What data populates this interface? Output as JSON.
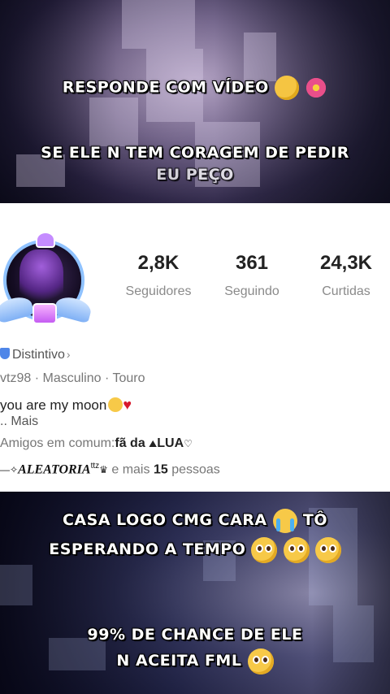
{
  "overlay": {
    "line1": "RESPONDE COM VÍDEO",
    "line2a": "SE ELE N TEM CORAGEM DE PEDIR",
    "line2b": "EU PEÇO",
    "line3a": "CASA LOGO CMG CARA",
    "line3a_tail": "TÔ",
    "line3b": "ESPERANDO A TEMPO",
    "line4a": "99% DE CHANCE DE ELE",
    "line4b": "N ACEITA FML"
  },
  "profile": {
    "stats": [
      {
        "value": "2,8K",
        "label": "Seguidores"
      },
      {
        "value": "361",
        "label": "Seguindo"
      },
      {
        "value": "24,3K",
        "label": "Curtidas"
      }
    ],
    "badge_label": "Distintivo",
    "username": "vtz98",
    "gender": "Masculino",
    "sign": "Touro",
    "separator": "·",
    "bio": "you are my moon",
    "more_label": "..  Mais",
    "mutual_prefix": "Amigos em comum:",
    "mutual_name": "fã da",
    "mutual_name2": "LUA",
    "friend_name": "ALEATORIA",
    "friend_suffix": "ttz",
    "and_more": "e mais",
    "count": "15",
    "people": "pessoas"
  },
  "icons": [
    "shield-icon",
    "chevron-right-icon",
    "smile-emoji-icon",
    "heart-icon",
    "pleading-face-icon",
    "crying-face-icon",
    "sneezing-face-icon",
    "flower-icon"
  ]
}
